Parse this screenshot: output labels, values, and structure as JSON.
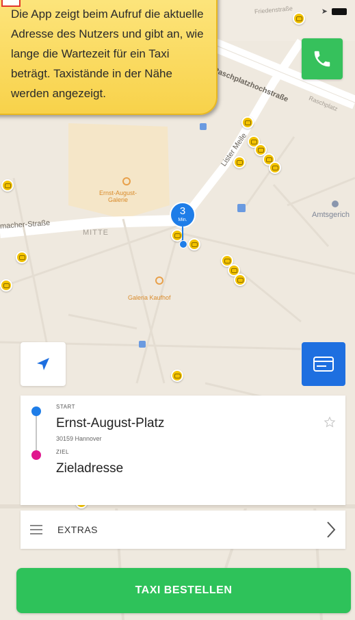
{
  "callout": {
    "text": "Die App zeigt beim Aufruf die aktuelle Adresse des Nutzers und gibt an, wie lange die Wartezeit für ein Taxi beträgt. Taxistände in der Nähe werden angezeigt."
  },
  "map": {
    "streets": {
      "hochstrasse": "Raschplatzhochstraße",
      "lister_meile": "Lister Meile",
      "schumacher": "macher-Straße",
      "mitte": "MITTE",
      "frieden": "Friedenstraße",
      "amtsgericht": "Amtsgerich",
      "raschplatz": "Raschplatz"
    },
    "pois": {
      "ernst_august_galerie": "Ernst-August-\nGalerie",
      "galeria_kaufhof": "Galeria Kaufhof"
    },
    "wait": {
      "value": "3",
      "unit": "Min."
    }
  },
  "route": {
    "start_label": "START",
    "start_address": "Ernst-August-Platz",
    "start_city": "30159 Hannover",
    "end_label": "ZIEL",
    "end_address": "Zieladresse"
  },
  "extras": {
    "label": "EXTRAS"
  },
  "order": {
    "label": "TAXI BESTELLEN"
  },
  "colors": {
    "accent_green": "#2ec25a",
    "accent_blue": "#1e6fe0",
    "destination_pink": "#e0168e",
    "taxi_yellow": "#f2c200"
  }
}
